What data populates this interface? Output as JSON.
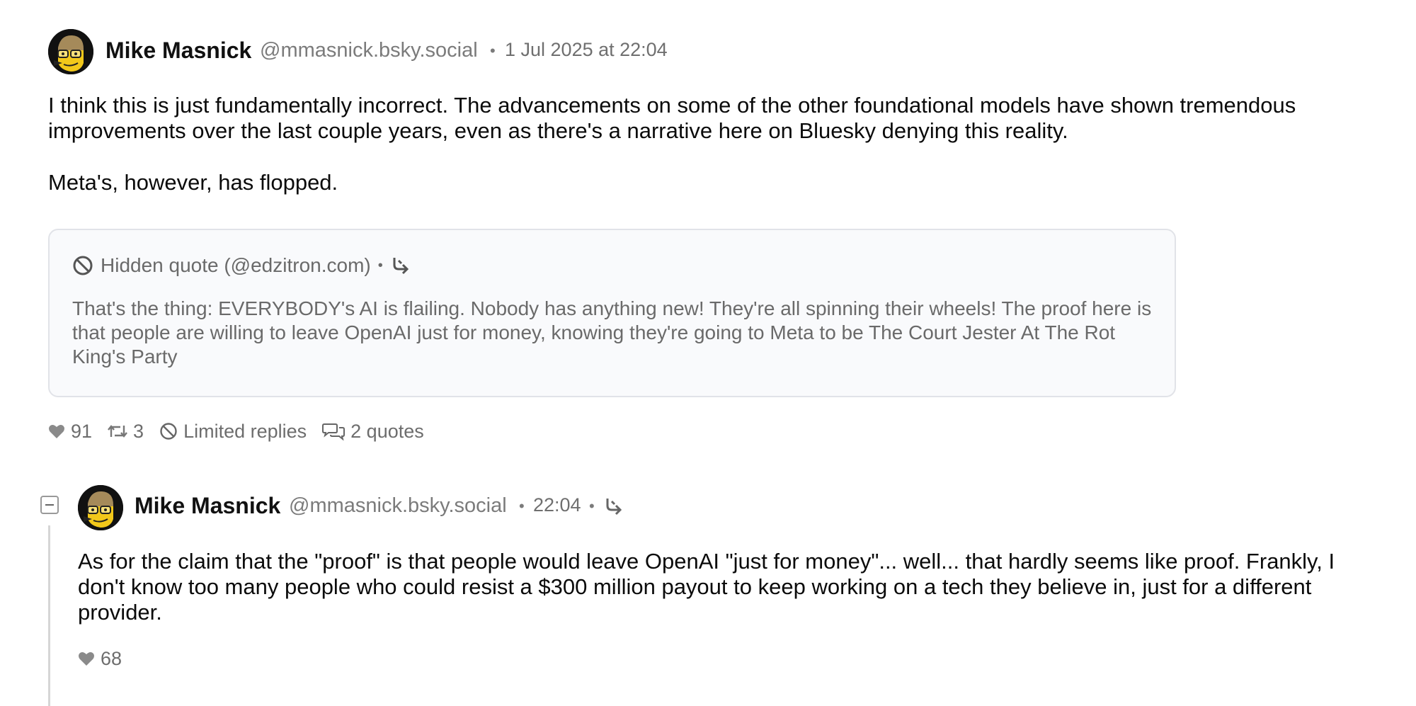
{
  "post": {
    "author_name": "Mike Masnick",
    "author_handle": "@mmasnick.bsky.social",
    "separator": "•",
    "timestamp": "1 Jul 2025 at 22:04",
    "avatar_icon": "cartoon-avatar-icon",
    "paragraphs": [
      "I think this is just fundamentally incorrect. The advancements on some of the other foundational models have shown tremendous improvements over the last couple years, even as there's a narrative here on Bluesky denying this reality.",
      "Meta's, however, has flopped."
    ],
    "quote": {
      "label": "Hidden quote (@edzitron.com)",
      "separator": "•",
      "icon_left": "blocked-icon",
      "icon_right": "open-thread-icon",
      "text": "That's the thing: EVERYBODY's AI is flailing. Nobody has anything new! They're all spinning their wheels! The proof here is that people are willing to leave OpenAI just for money, knowing they're going to Meta to be The Court Jester At The Rot King's Party"
    },
    "stats": {
      "likes": "91",
      "reposts": "3",
      "replies_label": "Limited replies",
      "quotes_label": "2 quotes"
    }
  },
  "reply": {
    "author_name": "Mike Masnick",
    "author_handle": "@mmasnick.bsky.social",
    "separator": "•",
    "timestamp": "22:04",
    "separator2": "•",
    "text": "As for the claim that the \"proof\" is that people would leave OpenAI \"just for money\"... well... that hardly seems like proof. Frankly, I don't know too many people who could resist a $300 million payout to keep working on a tech they believe in, just for a different provider.",
    "likes": "68"
  },
  "colors": {
    "muted": "#7b7b7b",
    "card_bg": "#f9fafc",
    "card_border": "#e1e3e8"
  }
}
